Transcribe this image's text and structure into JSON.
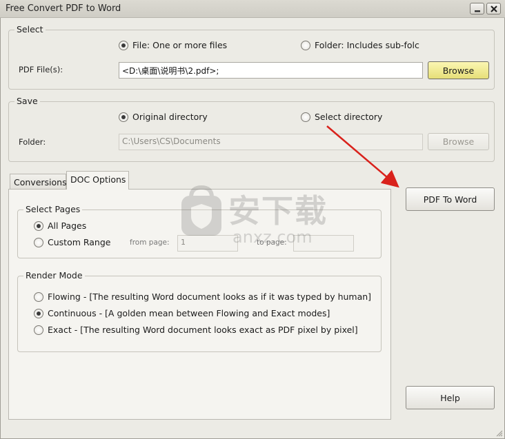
{
  "window": {
    "title": "Free Convert PDF to Word"
  },
  "select_group": {
    "title": "Select",
    "file_radio": "File:  One or more files",
    "folder_radio": "Folder: Includes sub-folc",
    "pdf_label": "PDF File(s):",
    "pdf_value": "<D:\\桌面\\说明书\\2.pdf>;",
    "browse": "Browse"
  },
  "save_group": {
    "title": "Save",
    "original_radio": "Original directory",
    "select_radio": "Select directory",
    "folder_label": "Folder:",
    "folder_value": "C:\\Users\\CS\\Documents",
    "browse": "Browse"
  },
  "tabs": [
    {
      "label": "Conversions",
      "active": false
    },
    {
      "label": "DOC Options",
      "active": true
    }
  ],
  "select_pages": {
    "title": "Select Pages",
    "all_pages": "All Pages",
    "custom_range": "Custom Range",
    "from_page": "from page:",
    "from_value": "1",
    "to_page": "to page:",
    "to_value": ""
  },
  "render_mode": {
    "title": "Render Mode",
    "flowing": "Flowing - [The resulting Word document looks as if it was typed by human]",
    "continuous": "Continuous - [A golden mean between Flowing and Exact modes]",
    "exact": "Exact - [The resulting Word document looks exact as PDF pixel by pixel]"
  },
  "actions": {
    "pdf_to_word": "PDF To Word",
    "help": "Help"
  },
  "watermark": {
    "text": "安下载",
    "url": "anxz.com"
  },
  "colors": {
    "window_bg": "#ecebe5",
    "highlight_button": "#efe892",
    "arrow": "#d9221c"
  }
}
